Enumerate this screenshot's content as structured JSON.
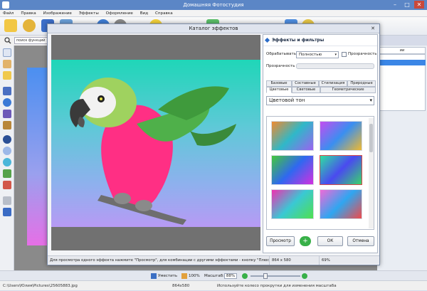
{
  "window": {
    "title": "Домашняя Фотостудия",
    "min": "–",
    "max": "□",
    "close": "✕"
  },
  "menu": [
    "Файл",
    "Правка",
    "Изображение",
    "Эффекты",
    "Оформление",
    "Вид",
    "Справка"
  ],
  "search": {
    "placeholder": "поиск функций"
  },
  "right_panel": {
    "tab_label": "ии"
  },
  "dialog": {
    "title": "Каталог эффектов",
    "close": "✕",
    "panel_title": "Эффекты и фильтры",
    "process_label": "Обрабатывать",
    "process_value": "Полностью",
    "transparency_check_label": "Прозрачность",
    "transparency_slider_label": "Прозрачность",
    "tabs_row1": [
      "Базовые",
      "Составные",
      "Стилизация",
      "Природные"
    ],
    "tabs_row2": [
      "Цветовые",
      "Световые",
      "Геометрические"
    ],
    "effect_value": "Цветовой тон",
    "buttons": {
      "preview": "Просмотр",
      "ok": "ОК",
      "cancel": "Отмена"
    },
    "status_hint": "Для просмотра одного эффекта нажмите \"Просмотр\", для комбинации с другими эффектами - кнопку \"Плюс\"",
    "status_size": "864 x 580",
    "status_zoom": "69%"
  },
  "bottom": {
    "fit": "Уместить",
    "zoom100": "100%",
    "scale_label": "Масштаб:",
    "scale_value": "88%",
    "zoom_level": 0.3
  },
  "status": {
    "path": "C:\\Users\\Юлия\\Pictures\\25605883.jpg",
    "size": "864x580",
    "hint": "Используйте колесо прокрутки для изменения масштаба"
  }
}
